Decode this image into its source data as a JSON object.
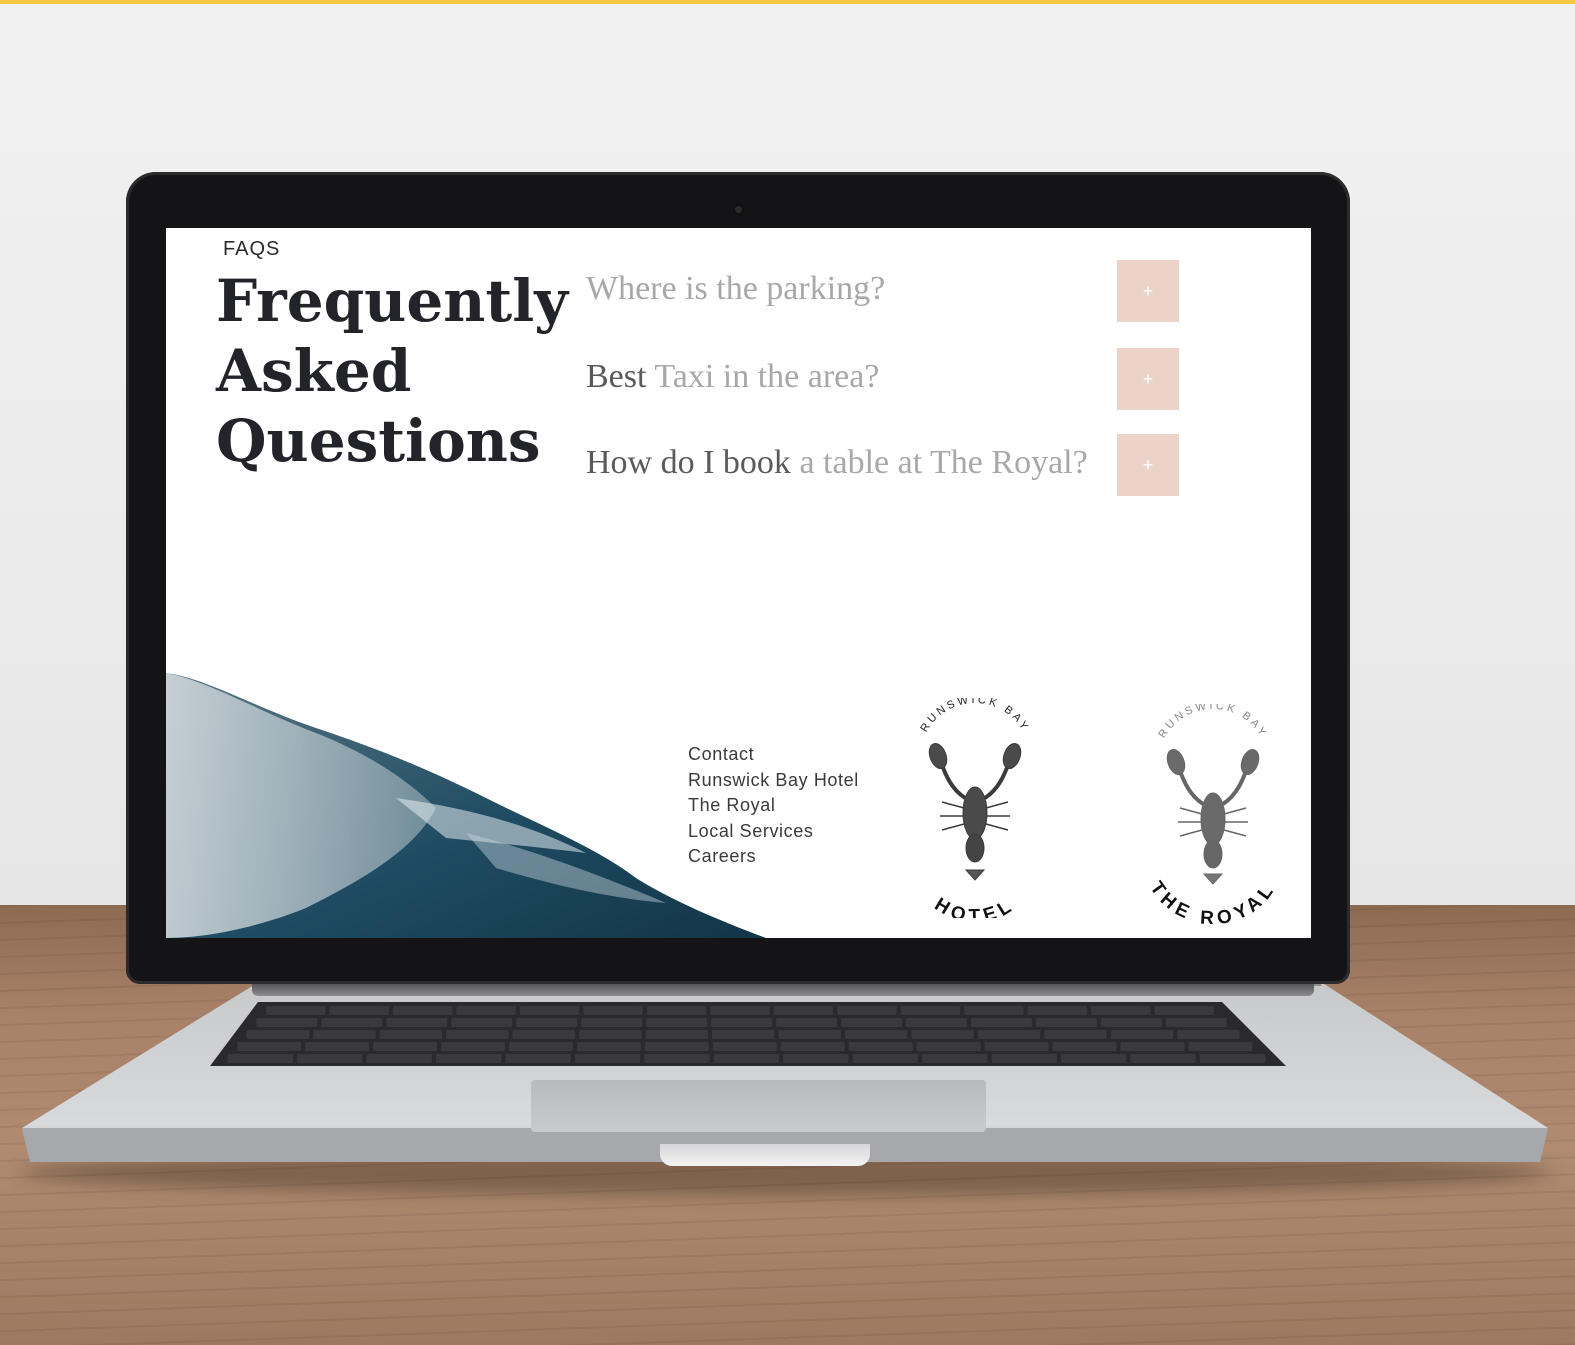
{
  "screen": {
    "faqs_label": "FAQS",
    "title_lines": [
      "Frequently",
      "Asked",
      "Questions"
    ],
    "questions": [
      {
        "dark_part": "",
        "light_part": "Where is the parking?",
        "button": "+"
      },
      {
        "dark_part": "Best",
        "light_part": " Taxi in the area?",
        "button": "+"
      },
      {
        "dark_part": "How do I book",
        "light_part": " a table at The Royal?",
        "button": "+"
      }
    ],
    "footer_links": [
      "Contact",
      "Runswick Bay Hotel",
      "The Royal",
      "Local Services",
      "Careers"
    ],
    "logos": [
      {
        "top_text": "RUNSWICK BAY",
        "bottom_text": "HOTEL",
        "icon": "lobster-icon"
      },
      {
        "top_text": "RUNSWICK BAY",
        "bottom_text": "THE ROYAL",
        "icon": "lobster-icon"
      }
    ]
  },
  "colors": {
    "accent_button": "#ecd3c9",
    "title": "#23242a",
    "question_light": "#a8a8a8",
    "top_bar": "#f7c843"
  }
}
